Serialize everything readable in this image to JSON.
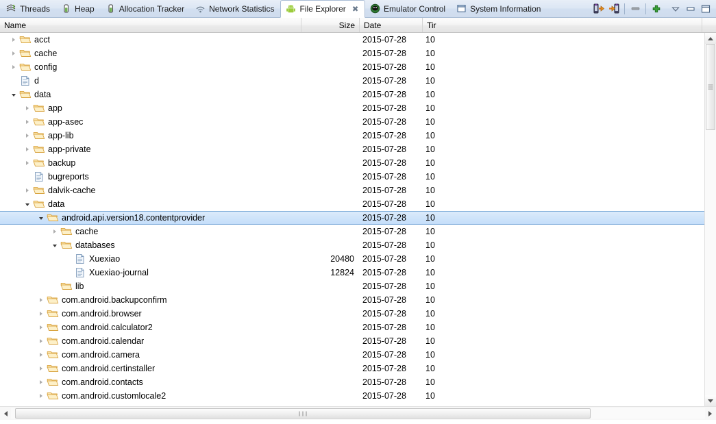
{
  "tabs": [
    {
      "label": "Threads",
      "icon": "threads-icon",
      "active": false
    },
    {
      "label": "Heap",
      "icon": "heap-icon",
      "active": false
    },
    {
      "label": "Allocation Tracker",
      "icon": "allocation-tracker-icon",
      "active": false
    },
    {
      "label": "Network Statistics",
      "icon": "network-statistics-icon",
      "active": false
    },
    {
      "label": "File Explorer",
      "icon": "android-icon",
      "active": true,
      "close": "✖"
    },
    {
      "label": "Emulator Control",
      "icon": "emulator-icon",
      "active": false
    },
    {
      "label": "System Information",
      "icon": "system-information-icon",
      "active": false
    }
  ],
  "toolbar": {
    "pull_file_label": "Pull a file from the device",
    "push_file_label": "Push a file onto the device",
    "delete_label": "Delete",
    "new_folder_label": "New Folder",
    "view_menu_label": "View Menu",
    "minimize_label": "Minimize",
    "maximize_label": "Maximize"
  },
  "columns": {
    "name": "Name",
    "size": "Size",
    "date": "Date",
    "time": "Tir"
  },
  "colors": {
    "selection": "#cfe4fa",
    "selection_border": "#7aa9d8",
    "tabbar": "#dce6f4",
    "folder": "#f5c977",
    "accent_green": "#3aa03a"
  },
  "rows": [
    {
      "name": "acct",
      "depth": 0,
      "type": "folder",
      "state": "collapsed",
      "size": "",
      "date": "2015-07-28",
      "time": "10",
      "selected": false
    },
    {
      "name": "cache",
      "depth": 0,
      "type": "folder",
      "state": "collapsed",
      "size": "",
      "date": "2015-07-28",
      "time": "10",
      "selected": false
    },
    {
      "name": "config",
      "depth": 0,
      "type": "folder",
      "state": "collapsed",
      "size": "",
      "date": "2015-07-28",
      "time": "10",
      "selected": false
    },
    {
      "name": "d",
      "depth": 0,
      "type": "file",
      "state": "leaf",
      "size": "",
      "date": "2015-07-28",
      "time": "10",
      "selected": false
    },
    {
      "name": "data",
      "depth": 0,
      "type": "folder",
      "state": "expanded",
      "size": "",
      "date": "2015-07-28",
      "time": "10",
      "selected": false
    },
    {
      "name": "app",
      "depth": 1,
      "type": "folder",
      "state": "collapsed",
      "size": "",
      "date": "2015-07-28",
      "time": "10",
      "selected": false
    },
    {
      "name": "app-asec",
      "depth": 1,
      "type": "folder",
      "state": "collapsed",
      "size": "",
      "date": "2015-07-28",
      "time": "10",
      "selected": false
    },
    {
      "name": "app-lib",
      "depth": 1,
      "type": "folder",
      "state": "collapsed",
      "size": "",
      "date": "2015-07-28",
      "time": "10",
      "selected": false
    },
    {
      "name": "app-private",
      "depth": 1,
      "type": "folder",
      "state": "collapsed",
      "size": "",
      "date": "2015-07-28",
      "time": "10",
      "selected": false
    },
    {
      "name": "backup",
      "depth": 1,
      "type": "folder",
      "state": "collapsed",
      "size": "",
      "date": "2015-07-28",
      "time": "10",
      "selected": false
    },
    {
      "name": "bugreports",
      "depth": 1,
      "type": "file",
      "state": "leaf",
      "size": "",
      "date": "2015-07-28",
      "time": "10",
      "selected": false
    },
    {
      "name": "dalvik-cache",
      "depth": 1,
      "type": "folder",
      "state": "collapsed",
      "size": "",
      "date": "2015-07-28",
      "time": "10",
      "selected": false
    },
    {
      "name": "data",
      "depth": 1,
      "type": "folder",
      "state": "expanded",
      "size": "",
      "date": "2015-07-28",
      "time": "10",
      "selected": false
    },
    {
      "name": "android.api.version18.contentprovider",
      "depth": 2,
      "type": "folder",
      "state": "expanded",
      "size": "",
      "date": "2015-07-28",
      "time": "10",
      "selected": true
    },
    {
      "name": "cache",
      "depth": 3,
      "type": "folder",
      "state": "collapsed",
      "size": "",
      "date": "2015-07-28",
      "time": "10",
      "selected": false
    },
    {
      "name": "databases",
      "depth": 3,
      "type": "folder",
      "state": "expanded",
      "size": "",
      "date": "2015-07-28",
      "time": "10",
      "selected": false
    },
    {
      "name": "Xuexiao",
      "depth": 4,
      "type": "file",
      "state": "leaf",
      "size": "20480",
      "date": "2015-07-28",
      "time": "10",
      "selected": false
    },
    {
      "name": "Xuexiao-journal",
      "depth": 4,
      "type": "file",
      "state": "leaf",
      "size": "12824",
      "date": "2015-07-28",
      "time": "10",
      "selected": false
    },
    {
      "name": "lib",
      "depth": 3,
      "type": "folder",
      "state": "leaf",
      "size": "",
      "date": "2015-07-28",
      "time": "10",
      "selected": false
    },
    {
      "name": "com.android.backupconfirm",
      "depth": 2,
      "type": "folder",
      "state": "collapsed",
      "size": "",
      "date": "2015-07-28",
      "time": "10",
      "selected": false
    },
    {
      "name": "com.android.browser",
      "depth": 2,
      "type": "folder",
      "state": "collapsed",
      "size": "",
      "date": "2015-07-28",
      "time": "10",
      "selected": false
    },
    {
      "name": "com.android.calculator2",
      "depth": 2,
      "type": "folder",
      "state": "collapsed",
      "size": "",
      "date": "2015-07-28",
      "time": "10",
      "selected": false
    },
    {
      "name": "com.android.calendar",
      "depth": 2,
      "type": "folder",
      "state": "collapsed",
      "size": "",
      "date": "2015-07-28",
      "time": "10",
      "selected": false
    },
    {
      "name": "com.android.camera",
      "depth": 2,
      "type": "folder",
      "state": "collapsed",
      "size": "",
      "date": "2015-07-28",
      "time": "10",
      "selected": false
    },
    {
      "name": "com.android.certinstaller",
      "depth": 2,
      "type": "folder",
      "state": "collapsed",
      "size": "",
      "date": "2015-07-28",
      "time": "10",
      "selected": false
    },
    {
      "name": "com.android.contacts",
      "depth": 2,
      "type": "folder",
      "state": "collapsed",
      "size": "",
      "date": "2015-07-28",
      "time": "10",
      "selected": false
    },
    {
      "name": "com.android.customlocale2",
      "depth": 2,
      "type": "folder",
      "state": "collapsed",
      "size": "",
      "date": "2015-07-28",
      "time": "10",
      "selected": false
    }
  ]
}
